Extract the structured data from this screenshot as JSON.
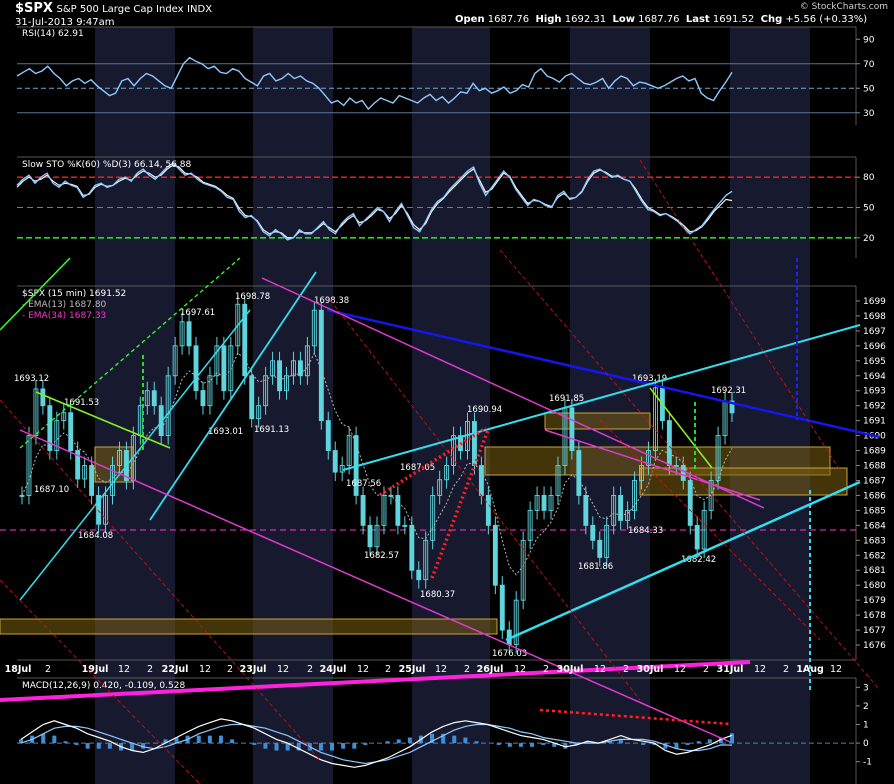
{
  "header": {
    "symbol": "$SPX",
    "name": "S&P 500 Large Cap Index",
    "exchange": "INDX",
    "datetime": "31-Jul-2013 9:47am",
    "watermark": "© StockCharts.com",
    "quote": {
      "open_label": "Open",
      "open": "1687.76",
      "high_label": "High",
      "high": "1692.31",
      "low_label": "Low",
      "low": "1687.76",
      "last_label": "Last",
      "last": "1691.52",
      "chg_label": "Chg",
      "chg": "+5.56 (+0.33%)"
    }
  },
  "colors": {
    "price_bar": "#5fd4dc",
    "ema13": "#b6b6b6",
    "ema34": "#ff33cc",
    "indicator": "#8ec9ff",
    "cyan_line": "#33ddee",
    "blue_line": "#1515ee",
    "magenta_line": "#e03ad0",
    "red_dash": "#ff2020",
    "green_dash": "#22dd22",
    "band_fill": "#7a5f13"
  },
  "chart_data": [
    {
      "type": "line",
      "panel": "rsi",
      "legend": "RSI(14) 62.91",
      "ylim": [
        20,
        100
      ],
      "yticks": [
        30,
        50,
        70,
        90
      ],
      "grid": true,
      "levels": [
        30,
        50,
        70
      ],
      "values": [
        60,
        63,
        66,
        62,
        64,
        68,
        62,
        58,
        52,
        56,
        58,
        54,
        57,
        52,
        48,
        44,
        46,
        56,
        58,
        52,
        58,
        62,
        60,
        56,
        52,
        50,
        60,
        70,
        75,
        72,
        70,
        66,
        68,
        63,
        62,
        66,
        64,
        58,
        55,
        52,
        60,
        62,
        56,
        58,
        62,
        58,
        60,
        56,
        54,
        50,
        44,
        38,
        40,
        36,
        42,
        38,
        40,
        33,
        38,
        42,
        40,
        38,
        44,
        42,
        40,
        38,
        42,
        45,
        40,
        43,
        38,
        42,
        47,
        46,
        54,
        48,
        50,
        46,
        48,
        51,
        46,
        48,
        53,
        51,
        62,
        66,
        60,
        58,
        55,
        60,
        62,
        58,
        54,
        53,
        55,
        58,
        50,
        56,
        60,
        58,
        52,
        55,
        54,
        52,
        50,
        52,
        55,
        58,
        60,
        56,
        58,
        46,
        42,
        40,
        48,
        55,
        63
      ]
    },
    {
      "type": "line",
      "panel": "slow_sto",
      "legend": "Slow STO %K(60) %D(3) 66.14, 56.88",
      "ylim": [
        0,
        100
      ],
      "yticks": [
        20,
        50,
        80
      ],
      "levels": [
        20,
        50,
        80
      ],
      "series": [
        {
          "name": "%K",
          "values": [
            72,
            78,
            82,
            74,
            80,
            84,
            74,
            70,
            76,
            72,
            70,
            60,
            64,
            72,
            74,
            70,
            72,
            78,
            80,
            76,
            84,
            88,
            82,
            78,
            84,
            90,
            94,
            88,
            82,
            84,
            78,
            74,
            72,
            70,
            66,
            60,
            58,
            46,
            40,
            42,
            36,
            26,
            22,
            28,
            24,
            18,
            20,
            28,
            24,
            24,
            30,
            36,
            28,
            24,
            34,
            40,
            44,
            32,
            38,
            44,
            50,
            46,
            36,
            46,
            54,
            42,
            30,
            26,
            36,
            48,
            56,
            60,
            68,
            74,
            80,
            86,
            90,
            74,
            62,
            70,
            78,
            86,
            80,
            68,
            60,
            52,
            58,
            56,
            52,
            50,
            62,
            66,
            58,
            60,
            66,
            78,
            86,
            88,
            84,
            80,
            82,
            78,
            76,
            66,
            56,
            48,
            46,
            42,
            44,
            40,
            36,
            30,
            24,
            28,
            32,
            40,
            48,
            55,
            62,
            66
          ]
        },
        {
          "name": "%D",
          "values": [
            70,
            76,
            80,
            76,
            78,
            82,
            76,
            72,
            74,
            73,
            71,
            62,
            63,
            70,
            73,
            71,
            72,
            76,
            79,
            77,
            82,
            86,
            84,
            80,
            82,
            88,
            92,
            90,
            84,
            83,
            80,
            75,
            73,
            71,
            67,
            62,
            59,
            49,
            42,
            41,
            37,
            28,
            24,
            26,
            25,
            20,
            20,
            26,
            25,
            25,
            29,
            34,
            30,
            26,
            32,
            38,
            42,
            35,
            37,
            42,
            48,
            46,
            39,
            44,
            52,
            44,
            33,
            28,
            34,
            46,
            54,
            59,
            66,
            72,
            78,
            84,
            88,
            77,
            65,
            68,
            76,
            84,
            81,
            70,
            62,
            54,
            57,
            56,
            53,
            51,
            60,
            64,
            59,
            60,
            65,
            76,
            84,
            87,
            85,
            81,
            81,
            78,
            76,
            68,
            58,
            50,
            47,
            43,
            44,
            41,
            37,
            32,
            26,
            27,
            31,
            38,
            46,
            52,
            58,
            56.88
          ]
        }
      ]
    },
    {
      "type": "candlestick",
      "panel": "price",
      "legend": {
        "price": "$SPX (15 min) 1691.52",
        "ema13": "EMA(13) 1687.80",
        "ema34": "EMA(34) 1687.33"
      },
      "ylim": [
        1675,
        1700
      ],
      "yticks": [
        1676,
        1677,
        1678,
        1679,
        1680,
        1681,
        1682,
        1683,
        1684,
        1685,
        1686,
        1687,
        1688,
        1689,
        1690,
        1691,
        1692,
        1693,
        1694,
        1695,
        1696,
        1697,
        1698,
        1699
      ],
      "close": [
        1686,
        1690,
        1693.12,
        1692,
        1689,
        1691,
        1691.53,
        1689,
        1687.1,
        1688,
        1686,
        1684.08,
        1686,
        1688,
        1689,
        1687,
        1690,
        1692,
        1693,
        1692,
        1690,
        1694,
        1696,
        1697.61,
        1696,
        1693.01,
        1692,
        1694,
        1696,
        1693,
        1696,
        1698.78,
        1694,
        1691.13,
        1692,
        1694,
        1695,
        1693,
        1694,
        1695,
        1694,
        1696,
        1698.38,
        1691,
        1689,
        1687.56,
        1688,
        1690,
        1686,
        1684,
        1682.57,
        1684,
        1686,
        1686,
        1684,
        1684,
        1681,
        1680.37,
        1683,
        1686,
        1687.05,
        1688,
        1690,
        1689,
        1690.94,
        1688,
        1686,
        1684,
        1680,
        1677,
        1676.03,
        1679,
        1683,
        1685,
        1686,
        1685,
        1686,
        1688,
        1691.85,
        1689,
        1686,
        1684,
        1683,
        1681.86,
        1684,
        1686,
        1684.33,
        1685,
        1687,
        1688,
        1689,
        1693.19,
        1691,
        1688,
        1688,
        1687,
        1684,
        1682.42,
        1685,
        1687,
        1690,
        1692.31,
        1691.52
      ],
      "annotations": [
        {
          "label": "1693.12"
        },
        {
          "label": "1691.53"
        },
        {
          "label": "1687.10"
        },
        {
          "label": "1684.08"
        },
        {
          "label": "1697.61"
        },
        {
          "label": "1693.01"
        },
        {
          "label": "1698.78"
        },
        {
          "label": "1691.13"
        },
        {
          "label": "1698.38"
        },
        {
          "label": "1687.56"
        },
        {
          "label": "1682.57"
        },
        {
          "label": "1687.05"
        },
        {
          "label": "1680.37"
        },
        {
          "label": "1690.94"
        },
        {
          "label": "1676.03"
        },
        {
          "label": "1691.85"
        },
        {
          "label": "1681.86"
        },
        {
          "label": "1684.33"
        },
        {
          "label": "1693.19"
        },
        {
          "label": "1682.42"
        },
        {
          "label": "1692.31"
        }
      ]
    },
    {
      "type": "line",
      "panel": "macd",
      "legend": "MACD(12,26,9) 0.420, -0.109, 0.528",
      "ylim": [
        -2.2,
        3.5
      ],
      "yticks": [
        -1,
        0,
        1,
        2,
        3
      ],
      "series": [
        {
          "name": "MACD",
          "values": [
            0.2,
            0.6,
            1.0,
            1.2,
            1.0,
            0.8,
            0.5,
            0.3,
            0.1,
            -0.2,
            -0.4,
            -0.5,
            -0.3,
            0.0,
            0.3,
            0.6,
            0.9,
            1.1,
            1.3,
            1.2,
            1.0,
            0.8,
            0.5,
            0.2,
            0.0,
            -0.3,
            -0.6,
            -0.9,
            -1.1,
            -1.2,
            -1.3,
            -1.2,
            -1.0,
            -0.8,
            -0.5,
            -0.2,
            0.2,
            0.6,
            0.9,
            1.1,
            1.2,
            1.1,
            1.0,
            0.8,
            0.6,
            0.4,
            0.3,
            0.2,
            0.0,
            -0.2,
            -0.1,
            0.1,
            0.0,
            0.2,
            0.4,
            0.2,
            0.1,
            0.0,
            -0.4,
            -0.6,
            -0.5,
            -0.3,
            -0.1,
            0.2,
            0.42
          ]
        },
        {
          "name": "Signal",
          "values": [
            0.0,
            0.2,
            0.5,
            0.8,
            0.9,
            0.9,
            0.8,
            0.6,
            0.4,
            0.2,
            0.0,
            -0.2,
            -0.3,
            -0.2,
            0.0,
            0.2,
            0.5,
            0.7,
            0.9,
            1.0,
            1.0,
            0.9,
            0.8,
            0.6,
            0.4,
            0.1,
            -0.2,
            -0.5,
            -0.7,
            -0.9,
            -1.0,
            -1.1,
            -1.0,
            -0.9,
            -0.7,
            -0.5,
            -0.2,
            0.1,
            0.4,
            0.7,
            0.9,
            1.0,
            1.0,
            0.9,
            0.8,
            0.6,
            0.5,
            0.3,
            0.2,
            0.1,
            0.0,
            0.0,
            0.0,
            0.1,
            0.2,
            0.2,
            0.2,
            0.1,
            -0.1,
            -0.3,
            -0.4,
            -0.4,
            -0.3,
            -0.1,
            -0.109
          ]
        }
      ]
    }
  ],
  "x_axis": {
    "labels": [
      "18Jul",
      "2",
      "19Jul",
      "12",
      "2",
      "22Jul",
      "12",
      "2",
      "23Jul",
      "12",
      "2",
      "24Jul",
      "12",
      "2",
      "25Jul",
      "12",
      "2",
      "26Jul",
      "12",
      "2",
      "30Jul",
      "12",
      "2",
      "30Jul",
      "12",
      "2",
      "31Jul",
      "12",
      "2",
      "1Aug",
      "12"
    ]
  }
}
